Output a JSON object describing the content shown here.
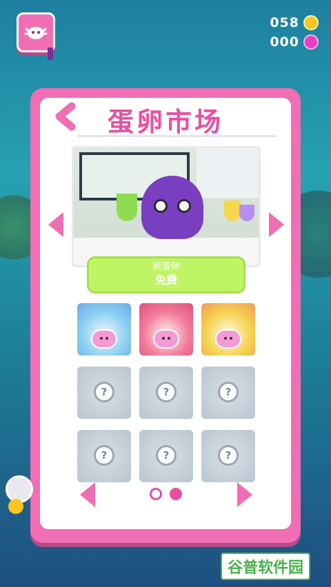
{
  "currency": {
    "coins": "058",
    "gems": "000"
  },
  "panel": {
    "title": "蛋卵市场"
  },
  "offer": {
    "name": "新蛋卵",
    "price": "免费"
  },
  "eggs": [
    {
      "state": "unlocked",
      "theme": "blue"
    },
    {
      "state": "unlocked",
      "theme": "red"
    },
    {
      "state": "unlocked",
      "theme": "yellow"
    },
    {
      "state": "locked",
      "badge": "?"
    },
    {
      "state": "locked",
      "badge": "?"
    },
    {
      "state": "locked",
      "badge": "?"
    },
    {
      "state": "locked",
      "badge": "?"
    },
    {
      "state": "locked",
      "badge": "?"
    },
    {
      "state": "locked",
      "badge": "?"
    }
  ],
  "pagination": {
    "current_page": 2,
    "total_pages": 2
  },
  "watermark": "谷普软件园",
  "colors": {
    "accent": "#ea4ea3",
    "panel": "#f06eb4",
    "offer": "#bff565"
  },
  "icons": [
    "book-icon",
    "coin-icon",
    "gem-icon",
    "back-arrow-icon",
    "left-arrow-icon",
    "right-arrow-icon",
    "lock-question-icon"
  ]
}
